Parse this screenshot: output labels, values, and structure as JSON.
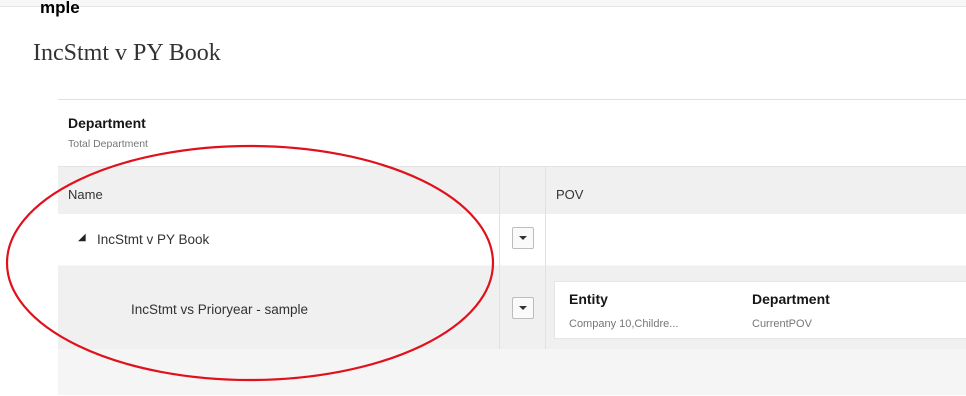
{
  "page": {
    "cut_text": "mple",
    "title": "IncStmt v PY Book"
  },
  "dimension": {
    "label": "Department",
    "value": "Total Department"
  },
  "grid": {
    "columns": {
      "name": "Name",
      "pov": "POV"
    },
    "rows": [
      {
        "name": "IncStmt v PY Book",
        "expanded": true
      },
      {
        "name": "IncStmt vs Prioryear - sample",
        "pov": [
          {
            "header": "Entity",
            "value": "Company 10,Childre..."
          },
          {
            "header": "Department",
            "value": "CurrentPOV"
          }
        ]
      }
    ]
  },
  "icons": {
    "expand": "collapse-triangle-icon",
    "dropdown": "chevron-down-icon"
  },
  "colors": {
    "annotation": "#e0111d"
  }
}
